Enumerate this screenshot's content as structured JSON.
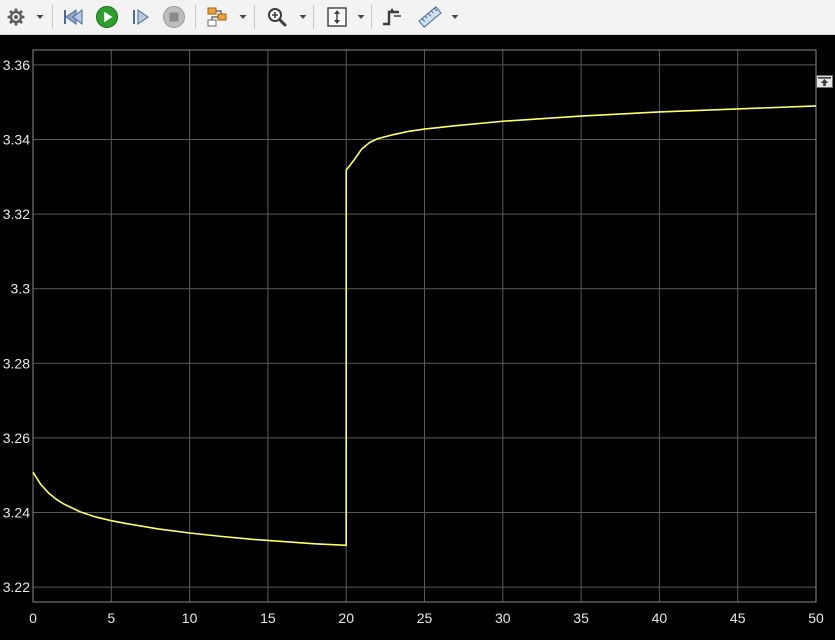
{
  "toolbar": {
    "items": [
      {
        "name": "settings-button",
        "icon": "gear-icon",
        "caret": true
      },
      {
        "name": "step-back-button",
        "icon": "step-back-icon",
        "caret": false
      },
      {
        "name": "run-button",
        "icon": "play-icon",
        "caret": false
      },
      {
        "name": "step-forward-button",
        "icon": "step-forward-icon",
        "caret": false
      },
      {
        "name": "stop-button",
        "icon": "stop-icon",
        "caret": false
      },
      {
        "name": "highlight-block-button",
        "icon": "block-diagram-icon",
        "caret": true
      },
      {
        "name": "zoom-button",
        "icon": "zoom-in-icon",
        "caret": true
      },
      {
        "name": "autoscale-button",
        "icon": "fit-to-view-icon",
        "caret": true
      },
      {
        "name": "triggers-button",
        "icon": "trigger-icon",
        "caret": false
      },
      {
        "name": "measurements-button",
        "icon": "ruler-icon",
        "caret": true
      }
    ]
  },
  "colors": {
    "background": "#000000",
    "grid": "#5a5a5a",
    "axis_frame": "#8a8a8a",
    "tick_text": "#e8e8e8",
    "signal": "#ffff66",
    "run_green": "#2e9e2e",
    "toolbar_bg": "#f3f3f3"
  },
  "chart_data": {
    "type": "line",
    "title": "",
    "xlabel": "",
    "ylabel": "",
    "xlim": [
      0,
      50
    ],
    "ylim": [
      3.216,
      3.364
    ],
    "grid": true,
    "xticks": [
      0,
      5,
      10,
      15,
      20,
      25,
      30,
      35,
      40,
      45,
      50
    ],
    "yticks": [
      3.22,
      3.24,
      3.26,
      3.28,
      3.3,
      3.32,
      3.34,
      3.36
    ],
    "xtick_labels": [
      "0",
      "5",
      "10",
      "15",
      "20",
      "25",
      "30",
      "35",
      "40",
      "45",
      "50"
    ],
    "ytick_labels": [
      "3.22",
      "3.24",
      "3.26",
      "3.28",
      "3.3",
      "3.32",
      "3.34",
      "3.36"
    ],
    "series": [
      {
        "x": [
          0,
          0.5,
          1,
          1.5,
          2,
          3,
          4,
          5,
          6,
          8,
          10,
          12,
          14,
          16,
          18,
          20,
          20.001,
          20.5,
          21,
          21.5,
          22,
          23,
          24,
          25,
          27,
          30,
          35,
          40,
          45,
          50
        ],
        "y": [
          3.2508,
          3.2475,
          3.2452,
          3.2435,
          3.2422,
          3.2402,
          3.2388,
          3.2378,
          3.237,
          3.2356,
          3.2345,
          3.2336,
          3.2328,
          3.2322,
          3.2316,
          3.2312,
          3.3318,
          3.3345,
          3.3375,
          3.3392,
          3.3402,
          3.3413,
          3.3422,
          3.3428,
          3.3437,
          3.3449,
          3.3463,
          3.3474,
          3.3482,
          3.349
        ]
      }
    ]
  }
}
